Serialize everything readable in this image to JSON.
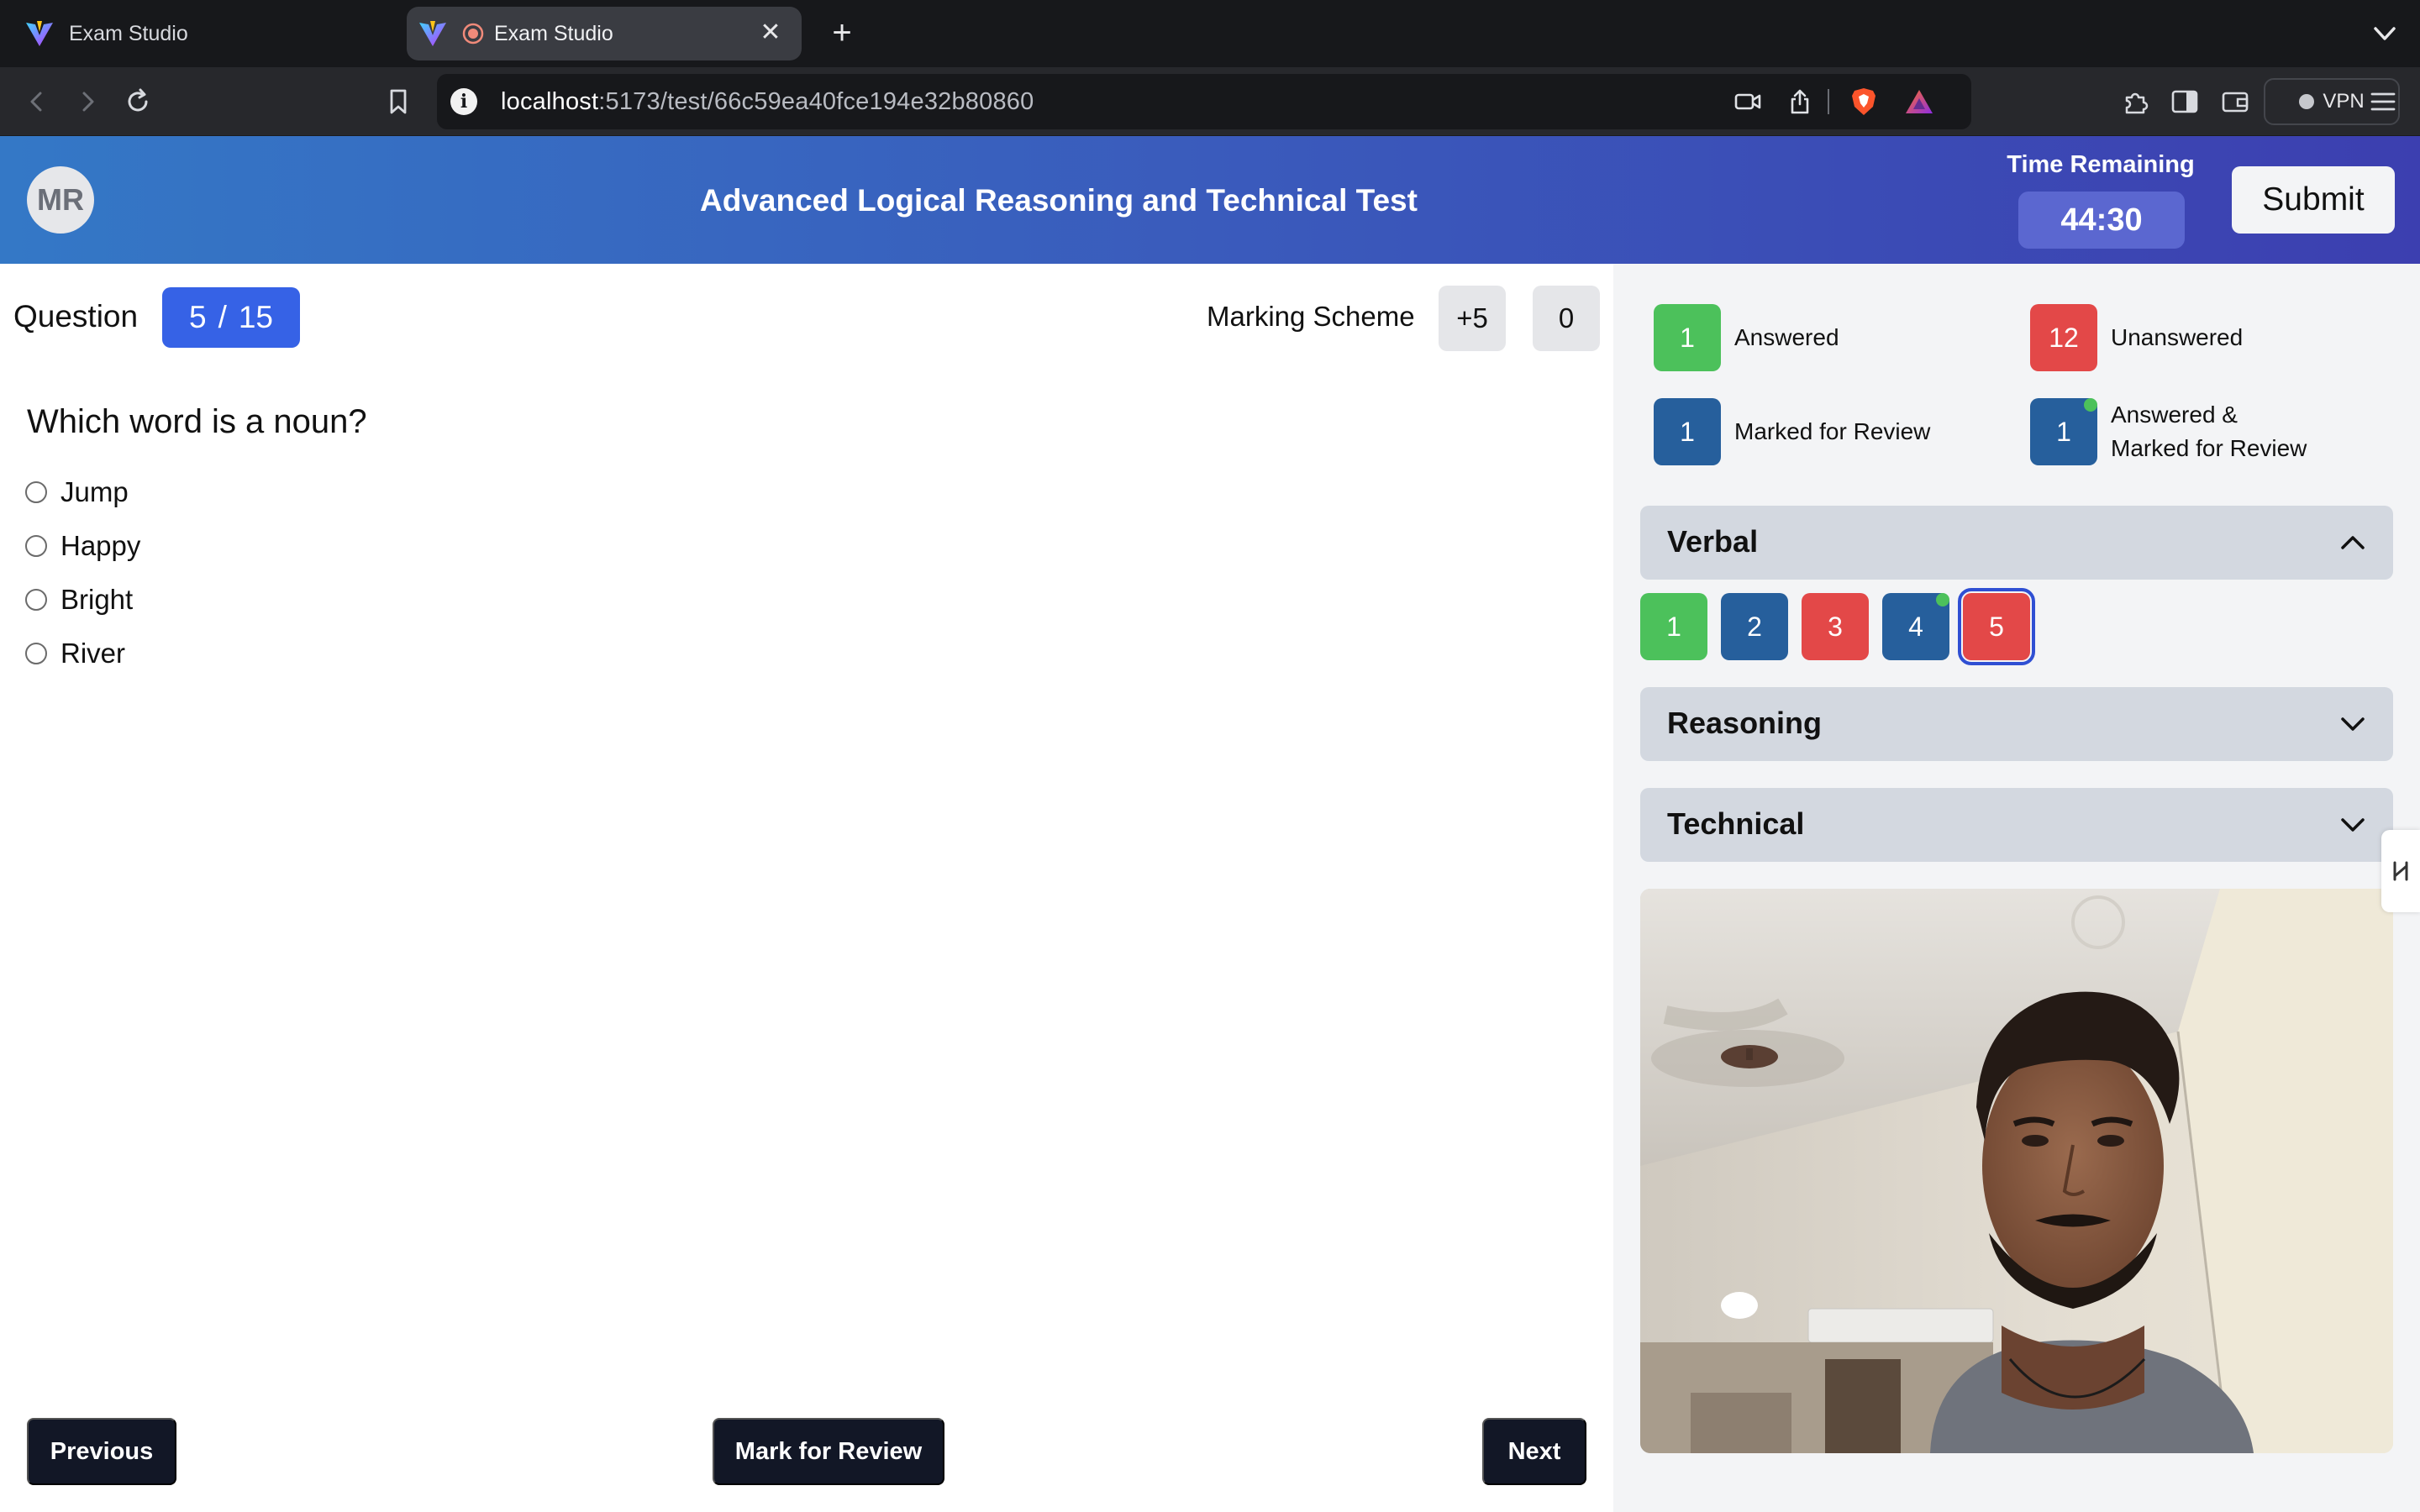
{
  "browser": {
    "tabs": [
      {
        "title": "Exam Studio",
        "active": false
      },
      {
        "title": "Exam Studio",
        "active": true
      }
    ],
    "url_host": "localhost",
    "url_path": ":5173/test/66c59ea40fce194e32b80860",
    "vpn_label": "VPN"
  },
  "header": {
    "avatar_initials": "MR",
    "title": "Advanced Logical Reasoning and Technical Test",
    "timer_label": "Time Remaining",
    "timer_value": "44:30",
    "submit_label": "Submit"
  },
  "question_panel": {
    "label": "Question",
    "current": "5",
    "separator": "/",
    "total": "15",
    "marking_scheme_label": "Marking Scheme",
    "marks_correct": "+5",
    "marks_wrong": "0",
    "question_text": "Which word is a noun?",
    "options": [
      "Jump",
      "Happy",
      "Bright",
      "River"
    ],
    "prev_label": "Previous",
    "review_label": "Mark for Review",
    "next_label": "Next"
  },
  "legend": {
    "answered": {
      "count": "1",
      "label": "Answered",
      "color": "#4cc15b"
    },
    "unanswered": {
      "count": "12",
      "label": "Unanswered",
      "color": "#e34848"
    },
    "marked": {
      "count": "1",
      "label": "Marked for Review",
      "color": "#265f9c"
    },
    "answered_marked": {
      "count": "1",
      "label_line1": "Answered &",
      "label_line2": "Marked for Review",
      "color": "#265f9c"
    }
  },
  "sections": [
    {
      "name": "Verbal",
      "expanded": true,
      "questions": [
        {
          "number": "1",
          "status": "answered"
        },
        {
          "number": "2",
          "status": "marked"
        },
        {
          "number": "3",
          "status": "unanswered"
        },
        {
          "number": "4",
          "status": "answered_marked"
        },
        {
          "number": "5",
          "status": "unanswered",
          "current": true
        }
      ]
    },
    {
      "name": "Reasoning",
      "expanded": false
    },
    {
      "name": "Technical",
      "expanded": false
    }
  ],
  "colors": {
    "header_start": "#3478c6",
    "header_end": "#3c3fb0",
    "accent": "#3662e6",
    "dark_button": "#121726"
  }
}
